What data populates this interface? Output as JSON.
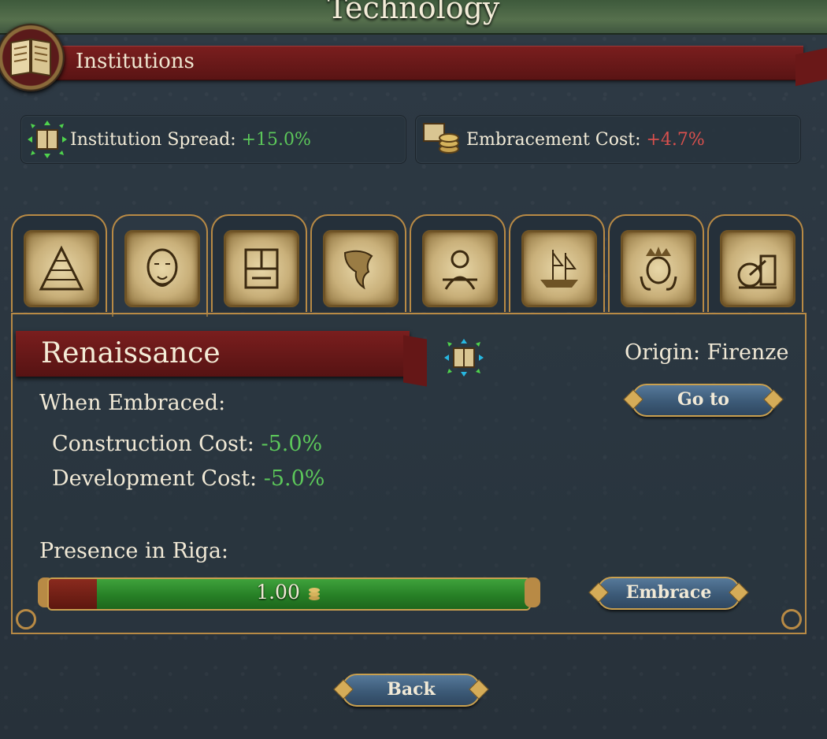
{
  "window": {
    "title": "Technology"
  },
  "section": {
    "label": "Institutions",
    "icon": "book-icon"
  },
  "stats": {
    "spread": {
      "label": "Institution Spread:",
      "value": "+15.0%",
      "icon": "institution-spread-icon",
      "color": "#5cc75a"
    },
    "embrace_cost": {
      "label": "Embracement Cost:",
      "value": "+4.7%",
      "icon": "embracement-cost-icon",
      "color": "#d9504d"
    }
  },
  "tabs": [
    {
      "icon": "pyramid-feudalism-icon"
    },
    {
      "icon": "renaissance-portrait-icon"
    },
    {
      "icon": "printing-press-icon"
    },
    {
      "icon": "new-world-map-icon"
    },
    {
      "icon": "merchant-icon"
    },
    {
      "icon": "sailing-ship-icon"
    },
    {
      "icon": "king-portrait-icon"
    },
    {
      "icon": "steam-engine-icon"
    }
  ],
  "institution": {
    "name": "Renaissance",
    "origin": "Origin: Firenze",
    "goto_label": "Go to",
    "when_embraced": "When Embraced:",
    "modifiers": [
      {
        "label": "Construction Cost:",
        "value": "-5.0%"
      },
      {
        "label": "Development Cost:",
        "value": "-5.0%"
      }
    ],
    "presence_label": "Presence in Riga:",
    "presence_value": "1.00",
    "presence_fraction": 1.0,
    "embrace_label": "Embrace"
  },
  "footer": {
    "back_label": "Back"
  },
  "colors": {
    "positive": "#5cc75a",
    "negative": "#d9504d",
    "gold_border": "#b88a45",
    "banner_red": "#7a1e1e"
  }
}
